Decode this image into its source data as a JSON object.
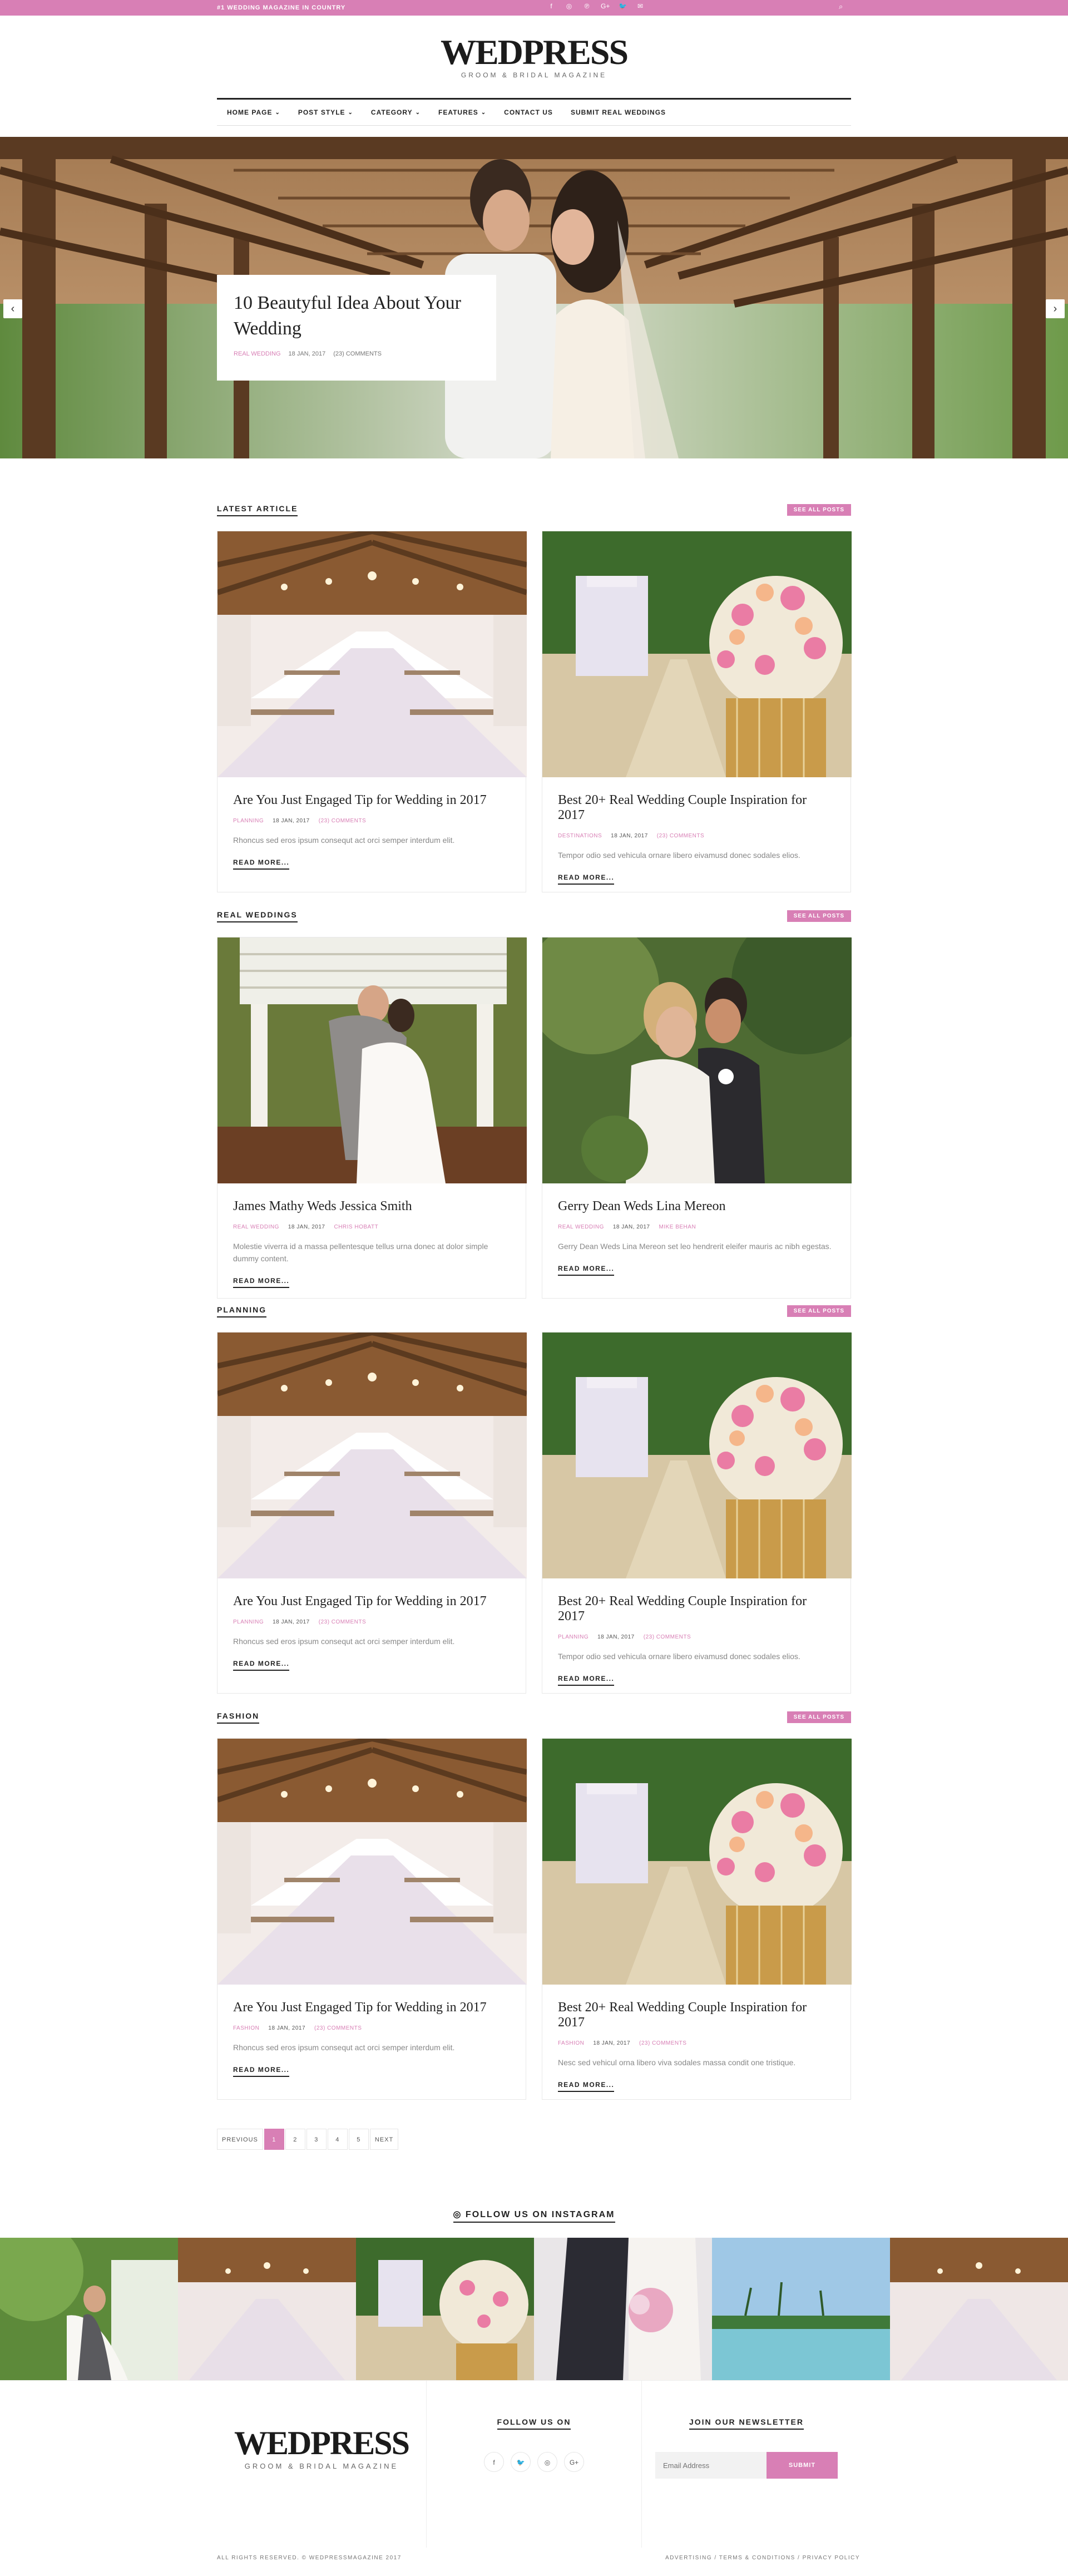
{
  "topbar": {
    "tagline": "#1 WEDDING MAGAZINE IN COUNTRY",
    "social": [
      "f",
      "◎",
      "℗",
      "G+",
      "🐦",
      "✉"
    ],
    "search_icon": "⌕"
  },
  "brand": {
    "name": "WEDPRESS",
    "tagline": "GROOM & BRIDAL MAGAZINE"
  },
  "nav": [
    {
      "label": "HOME PAGE",
      "dropdown": true
    },
    {
      "label": "POST STYLE",
      "dropdown": true
    },
    {
      "label": "CATEGORY",
      "dropdown": true
    },
    {
      "label": "FEATURES",
      "dropdown": true
    },
    {
      "label": "CONTACT US",
      "dropdown": false
    },
    {
      "label": "SUBMIT REAL WEDDINGS",
      "dropdown": false
    }
  ],
  "hero": {
    "title": "10 Beautyful Idea About Your Wedding",
    "category": "REAL WEDDING",
    "date": "18 JAN, 2017",
    "comments": "(23) COMMENTS"
  },
  "see_all": "SEE ALL POSTS",
  "read_more": "READ MORE...",
  "sections": [
    {
      "label": "LATEST ARTICLE",
      "cards": [
        {
          "title": "Are You Just Engaged Tip for Wedding in 2017",
          "category": "PLANNING",
          "date": "18 JAN, 2017",
          "extra": "(23) COMMENTS",
          "excerpt": "Rhoncus sed eros ipsum consequt act orci semper interdum elit."
        },
        {
          "title": "Best 20+ Real Wedding Couple Inspiration for 2017",
          "category": "DESTINATIONS",
          "date": "18 JAN, 2017",
          "extra": "(23) COMMENTS",
          "excerpt": "Tempor odio sed vehicula ornare libero eivamusd donec sodales elios."
        }
      ]
    },
    {
      "label": "REAL WEDDINGS",
      "cards": [
        {
          "title": "James Mathy Weds Jessica Smith",
          "category": "REAL WEDDING",
          "date": "18 JAN, 2017",
          "extra": "CHRIS HOBATT",
          "excerpt": "Molestie viverra id a massa pellentesque tellus urna donec at dolor simple dummy content."
        },
        {
          "title": "Gerry Dean Weds Lina Mereon",
          "category": "REAL WEDDING",
          "date": "18 JAN, 2017",
          "extra": "MIKE BEHAN",
          "excerpt": "Gerry Dean Weds Lina Mereon set leo hendrerit eleifer mauris ac nibh egestas."
        }
      ]
    },
    {
      "label": "PLANNING",
      "cards": [
        {
          "title": "Are You Just Engaged Tip for Wedding in 2017",
          "category": "PLANNING",
          "date": "18 JAN, 2017",
          "extra": "(23) COMMENTS",
          "excerpt": "Rhoncus sed eros ipsum consequt act orci semper interdum elit."
        },
        {
          "title": "Best 20+ Real Wedding Couple Inspiration for 2017",
          "category": "PLANNING",
          "date": "18 JAN, 2017",
          "extra": "(23) COMMENTS",
          "excerpt": "Tempor odio sed vehicula ornare libero eivamusd donec sodales elios."
        }
      ]
    },
    {
      "label": "FASHION",
      "cards": [
        {
          "title": "Are You Just Engaged Tip for Wedding in 2017",
          "category": "FASHION",
          "date": "18 JAN, 2017",
          "extra": "(23) COMMENTS",
          "excerpt": "Rhoncus sed eros ipsum consequt act orci semper interdum elit."
        },
        {
          "title": "Best 20+ Real Wedding Couple Inspiration for 2017",
          "category": "FASHION",
          "date": "18 JAN, 2017",
          "extra": "(23) COMMENTS",
          "excerpt": "Nesc sed vehicul ornа libero viva sodales massa condit one tristique."
        }
      ]
    }
  ],
  "pagination": {
    "prev": "PREVIOUS",
    "pages": [
      "1",
      "2",
      "3",
      "4",
      "5"
    ],
    "active": "1",
    "next": "NEXT"
  },
  "instagram": {
    "heading": "FOLLOW US ON INSTAGRAM",
    "icon": "◎"
  },
  "footer": {
    "follow_heading": "FOLLOW US ON",
    "follow_icons": [
      "f",
      "🐦",
      "◎",
      "G+"
    ],
    "newsletter_heading": "JOIN OUR NEWSLETTER",
    "email_placeholder": "Email Address",
    "submit": "SUBMIT",
    "copyright": "ALL RIGHTS RESERVED. © WEDPRESSMAGAZINE 2017",
    "links": "ADVERTISING / TERMS & CONDITIONS / PRIVACY POLICY"
  },
  "colors": {
    "accent": "#d87fb5"
  }
}
